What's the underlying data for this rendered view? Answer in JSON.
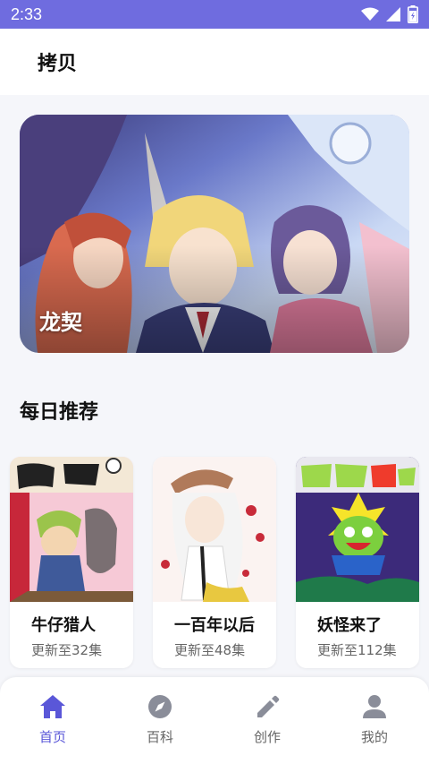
{
  "status_bar": {
    "time": "2:33",
    "icons": [
      "wifi-icon",
      "signal-icon",
      "battery-icon"
    ]
  },
  "header": {
    "title": "拷贝"
  },
  "banner": {
    "title": "龙契",
    "page_count": 3,
    "active_index": 0
  },
  "daily": {
    "section_title": "每日推荐",
    "items": [
      {
        "title": "牛仔猎人",
        "subtitle": "更新至32集"
      },
      {
        "title": "一百年以后",
        "subtitle": "更新至48集"
      },
      {
        "title": "妖怪来了",
        "subtitle": "更新至112集"
      }
    ]
  },
  "tabbar": {
    "tabs": [
      {
        "label": "首页",
        "icon": "home-icon",
        "active": true
      },
      {
        "label": "百科",
        "icon": "compass-icon",
        "active": false
      },
      {
        "label": "创作",
        "icon": "pencil-icon",
        "active": false
      },
      {
        "label": "我的",
        "icon": "user-icon",
        "active": false
      }
    ]
  },
  "colors": {
    "status_bar": "#6f6cdf",
    "accent": "#5a57d8",
    "inactive_icon": "#8a8d99"
  }
}
